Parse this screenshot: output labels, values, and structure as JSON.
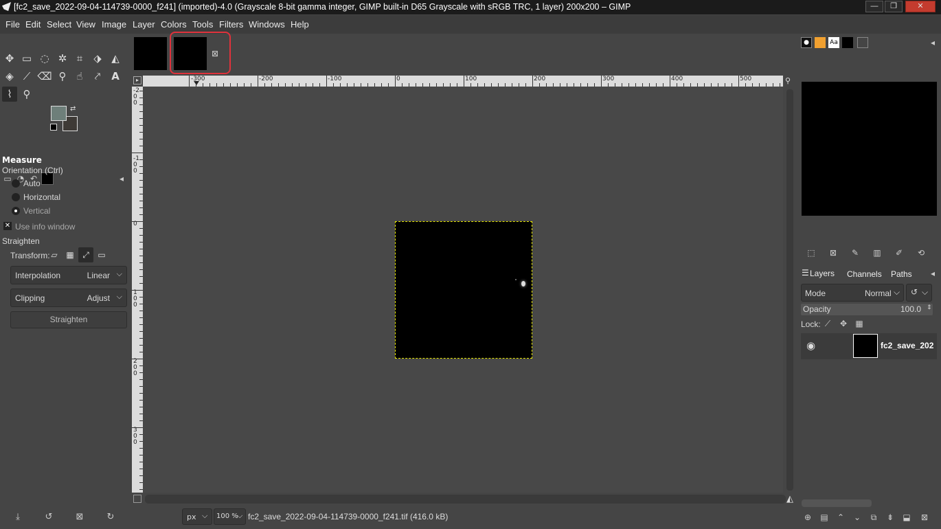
{
  "window": {
    "title": "[fc2_save_2022-09-04-114739-0000_f241] (imported)-4.0 (Grayscale 8-bit gamma integer, GIMP built-in D65 Grayscale with sRGB TRC, 1 layer) 200x200 – GIMP",
    "minimize": "—",
    "maximize": "❐",
    "close": "✕"
  },
  "menu": [
    "File",
    "Edit",
    "Select",
    "View",
    "Image",
    "Layer",
    "Colors",
    "Tools",
    "Filters",
    "Windows",
    "Help"
  ],
  "tool_options": {
    "title": "Measure",
    "orientation_label": "Orientation  (Ctrl)",
    "orientation_options": [
      "Auto",
      "Horizontal",
      "Vertical"
    ],
    "orientation_selected": "Vertical",
    "use_info_window": "Use info window",
    "straighten_label": "Straighten",
    "transform_label": "Transform:",
    "interpolation_label": "Interpolation",
    "interpolation_value": "Linear",
    "clipping_label": "Clipping",
    "clipping_value": "Adjust",
    "straighten_button": "Straighten"
  },
  "rulers": {
    "h_labels": [
      "-300",
      "-200",
      "-100",
      "0",
      "100",
      "200",
      "300",
      "400",
      "500"
    ],
    "v_labels": [
      "-200",
      "-100",
      "0",
      "100",
      "200",
      "300"
    ]
  },
  "status": {
    "unit": "px",
    "zoom": "100 %",
    "file": "fc2_save_2022-09-04-114739-0000_f241.tif (416.0 kB)"
  },
  "layers_panel": {
    "tabs": [
      "Layers",
      "Channels",
      "Paths"
    ],
    "mode_label": "Mode",
    "mode_value": "Normal",
    "opacity_label": "Opacity",
    "opacity_value": "100.0",
    "lock_label": "Lock:",
    "layer_name": "fc2_save_202"
  },
  "colors": {
    "foreground": "#6e7f7a",
    "background": "#3e3a36",
    "highlight": "#e0323c",
    "selection": "#e8e800"
  }
}
